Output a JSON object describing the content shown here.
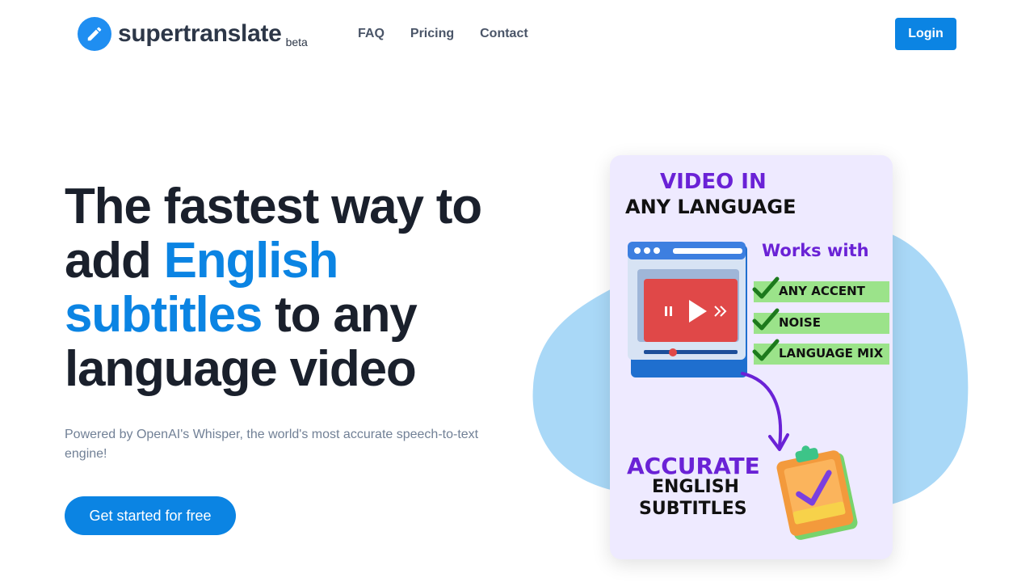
{
  "header": {
    "logo_text": "supertranslate",
    "logo_badge": "beta",
    "logo_icon": "pencil-icon",
    "nav": [
      {
        "label": "FAQ"
      },
      {
        "label": "Pricing"
      },
      {
        "label": "Contact"
      }
    ],
    "login_label": "Login"
  },
  "hero": {
    "headline_line1": "The fastest way to",
    "headline_add": "add ",
    "headline_english": "English",
    "headline_subtitles": "subtitles",
    "headline_to_any": " to any",
    "headline_line4": "language video",
    "subtext": "Powered by OpenAI's Whisper, the world's most accurate speech-to-text engine!",
    "cta_label": "Get started for free"
  },
  "illustration": {
    "video_in": "VIDEO IN",
    "any_language": "ANY LANGUAGE",
    "works_with": "Works with",
    "features": [
      "ANY ACCENT",
      "NOISE",
      "LANGUAGE MIX"
    ],
    "accurate": "ACCURATE",
    "english": "ENGLISH",
    "subtitles": "SUBTITLES"
  },
  "colors": {
    "primary": "#0b84e3",
    "logo_circle": "#1f8ef1",
    "heading": "#1a202c",
    "muted": "#718096",
    "purple": "#6a22d6",
    "feature_bg": "#9be38a",
    "blob": "#a9d8f7"
  }
}
